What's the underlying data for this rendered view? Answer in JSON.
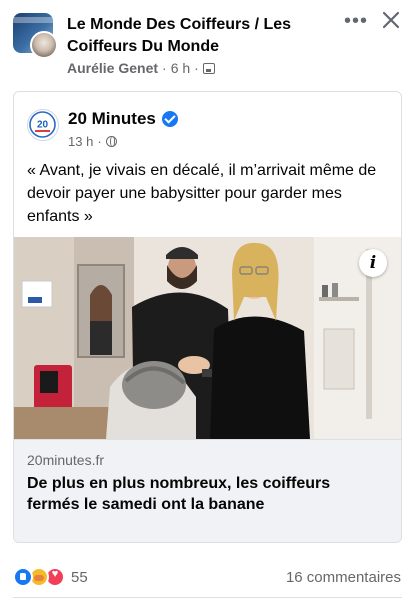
{
  "post": {
    "group_name": "Le Monde Des Coiffeurs / Les Coiffeurs Du Monde",
    "author": "Aurélie Genet",
    "time": "6 h",
    "separator": "·",
    "privacy_icon": "photo-icon"
  },
  "actions": {
    "more_icon": "more-icon",
    "more_label": "•••",
    "close_icon": "close-icon"
  },
  "shared": {
    "source_name": "20 Minutes",
    "source_logo_text": "20",
    "verified_icon": "verified-icon",
    "time": "13 h",
    "separator": "·",
    "privacy_icon": "globe-icon",
    "quote": "« Avant, je vivais en décalé, il m’arrivait même de devoir payer une babysitter pour garder mes enfants »"
  },
  "article": {
    "info_label": "i",
    "domain": "20minutes.fr",
    "title": "De plus en plus nombreux, les coiffeurs fermés le samedi ont la banane"
  },
  "engagement": {
    "reactions": [
      "like",
      "care",
      "love"
    ],
    "reaction_count": "55",
    "comments": "16 commentaires"
  },
  "colors": {
    "accent": "#1877f2",
    "secondary_text": "#65676b",
    "like": "#1877f2",
    "care": "#f7b928",
    "love": "#f33e58"
  }
}
